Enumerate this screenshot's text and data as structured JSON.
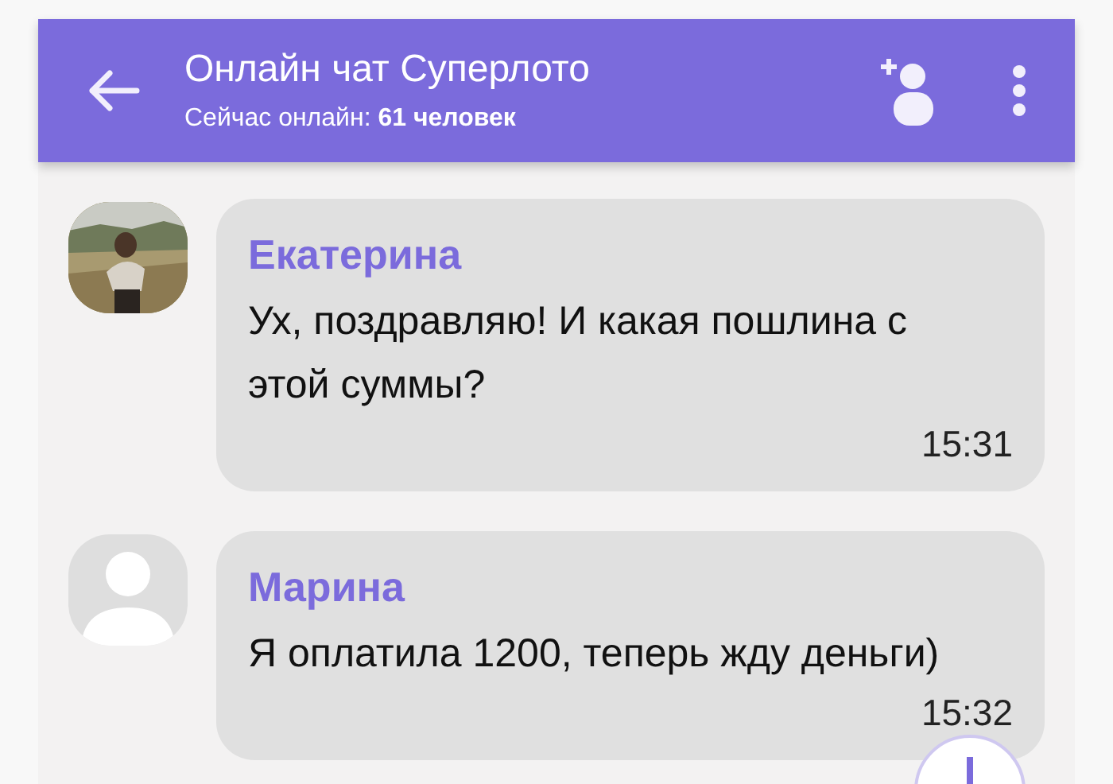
{
  "header": {
    "title": "Онлайн чат Суперлото",
    "subtitle": "Сейчас онлайн: **61 человек**"
  },
  "messages": [
    {
      "author": "Екатерина",
      "text": "Ух, поздравляю! И какая пошлина с этой суммы?",
      "time": "15:31"
    },
    {
      "author": "Марина",
      "avatar": {
        "kind": "placeholder"
      },
      "text": "Я оплатила 1200, теперь жду деньги)",
      "time": "15:32"
    }
  ]
}
